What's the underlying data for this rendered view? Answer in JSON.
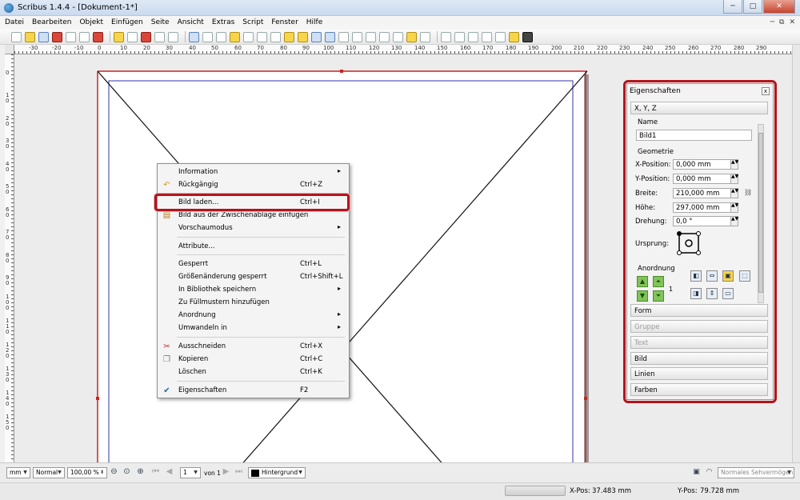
{
  "window": {
    "title": "Scribus 1.4.4 - [Dokument-1*]",
    "controls": [
      "─",
      "□",
      "✕"
    ]
  },
  "menubar": {
    "items": [
      "Datei",
      "Bearbeiten",
      "Objekt",
      "Einfügen",
      "Seite",
      "Ansicht",
      "Extras",
      "Script",
      "Fenster",
      "Hilfe"
    ],
    "mdi_controls": [
      "─",
      "⧉",
      "✕"
    ]
  },
  "rulers": {
    "horizontal": [
      "-30",
      "-20",
      "-10",
      "0",
      "10",
      "20",
      "30",
      "40",
      "50",
      "60",
      "70",
      "80",
      "90",
      "100",
      "110",
      "120",
      "130",
      "140",
      "150",
      "160",
      "170",
      "180",
      "190",
      "200",
      "210",
      "220",
      "230",
      "240",
      "250",
      "260",
      "270",
      "280",
      "290"
    ],
    "vertical": [
      "0",
      "10",
      "20",
      "30",
      "40",
      "50",
      "60",
      "70",
      "80",
      "90",
      "100",
      "110",
      "120",
      "130",
      "140",
      "150"
    ]
  },
  "context_menu": {
    "items": [
      {
        "label": "Information",
        "shortcut": "",
        "submenu": true,
        "icon": ""
      },
      {
        "label": "Rückgängig",
        "shortcut": "Ctrl+Z",
        "submenu": false,
        "icon": "undo-icon"
      },
      {
        "label": "Bild laden...",
        "shortcut": "Ctrl+I",
        "submenu": false,
        "icon": ""
      },
      {
        "label": "Bild aus der Zwischenablage einfügen",
        "shortcut": "",
        "submenu": false,
        "icon": "clipboard-icon"
      },
      {
        "label": "Vorschaumodus",
        "shortcut": "",
        "submenu": true,
        "icon": ""
      },
      {
        "label": "Attribute...",
        "shortcut": "",
        "submenu": false,
        "icon": ""
      },
      {
        "label": "Gesperrt",
        "shortcut": "Ctrl+L",
        "submenu": false,
        "icon": ""
      },
      {
        "label": "Größenänderung gesperrt",
        "shortcut": "Ctrl+Shift+L",
        "submenu": false,
        "icon": ""
      },
      {
        "label": "In Bibliothek speichern",
        "shortcut": "",
        "submenu": true,
        "icon": ""
      },
      {
        "label": "Zu Füllmustern hinzufügen",
        "shortcut": "",
        "submenu": false,
        "icon": ""
      },
      {
        "label": "Anordnung",
        "shortcut": "",
        "submenu": true,
        "icon": ""
      },
      {
        "label": "Umwandeln in",
        "shortcut": "",
        "submenu": true,
        "icon": ""
      },
      {
        "label": "Ausschneiden",
        "shortcut": "Ctrl+X",
        "submenu": false,
        "icon": "scissors-icon"
      },
      {
        "label": "Kopieren",
        "shortcut": "Ctrl+C",
        "submenu": false,
        "icon": "copy-icon"
      },
      {
        "label": "Löschen",
        "shortcut": "Ctrl+K",
        "submenu": false,
        "icon": ""
      },
      {
        "label": "Eigenschaften",
        "shortcut": "F2",
        "submenu": false,
        "icon": "checkmark-icon"
      }
    ]
  },
  "properties": {
    "title": "Eigenschaften",
    "close": "x",
    "section_xyz": "X, Y, Z",
    "name_label": "Name",
    "name_value": "Bild1",
    "geometry_label": "Geometrie",
    "fields": [
      {
        "label": "X-Position:",
        "value": "0,000 mm"
      },
      {
        "label": "Y-Position:",
        "value": "0,000 mm"
      },
      {
        "label": "Breite:",
        "value": "210,000 mm"
      },
      {
        "label": "Höhe:",
        "value": "297,000 mm"
      },
      {
        "label": "Drehung:",
        "value": "0,0 °"
      }
    ],
    "origin_label": "Ursprung:",
    "arrangement_label": "Anordnung",
    "level_value": "1",
    "sections": [
      {
        "label": "Form",
        "enabled": true
      },
      {
        "label": "Gruppe",
        "enabled": false
      },
      {
        "label": "Text",
        "enabled": false
      },
      {
        "label": "Bild",
        "enabled": true
      },
      {
        "label": "Linien",
        "enabled": true
      },
      {
        "label": "Farben",
        "enabled": true
      }
    ]
  },
  "bottombar": {
    "unit": "mm",
    "mode": "Normal",
    "zoom": "100,00 %",
    "page": "1",
    "page_of": "von 1",
    "layer": "Hintergrund",
    "vision": "Normales Sehvermögen"
  },
  "statusbar": {
    "xpos_label": "X-Pos:",
    "xpos_value": "37.483 mm",
    "ypos_label": "Y-Pos:",
    "ypos_value": "79.728 mm"
  },
  "colors": {
    "highlight": "#b5131c",
    "page_border": "#cc2222",
    "margin_guide": "#3333aa",
    "layer_swatch": "#000000"
  }
}
